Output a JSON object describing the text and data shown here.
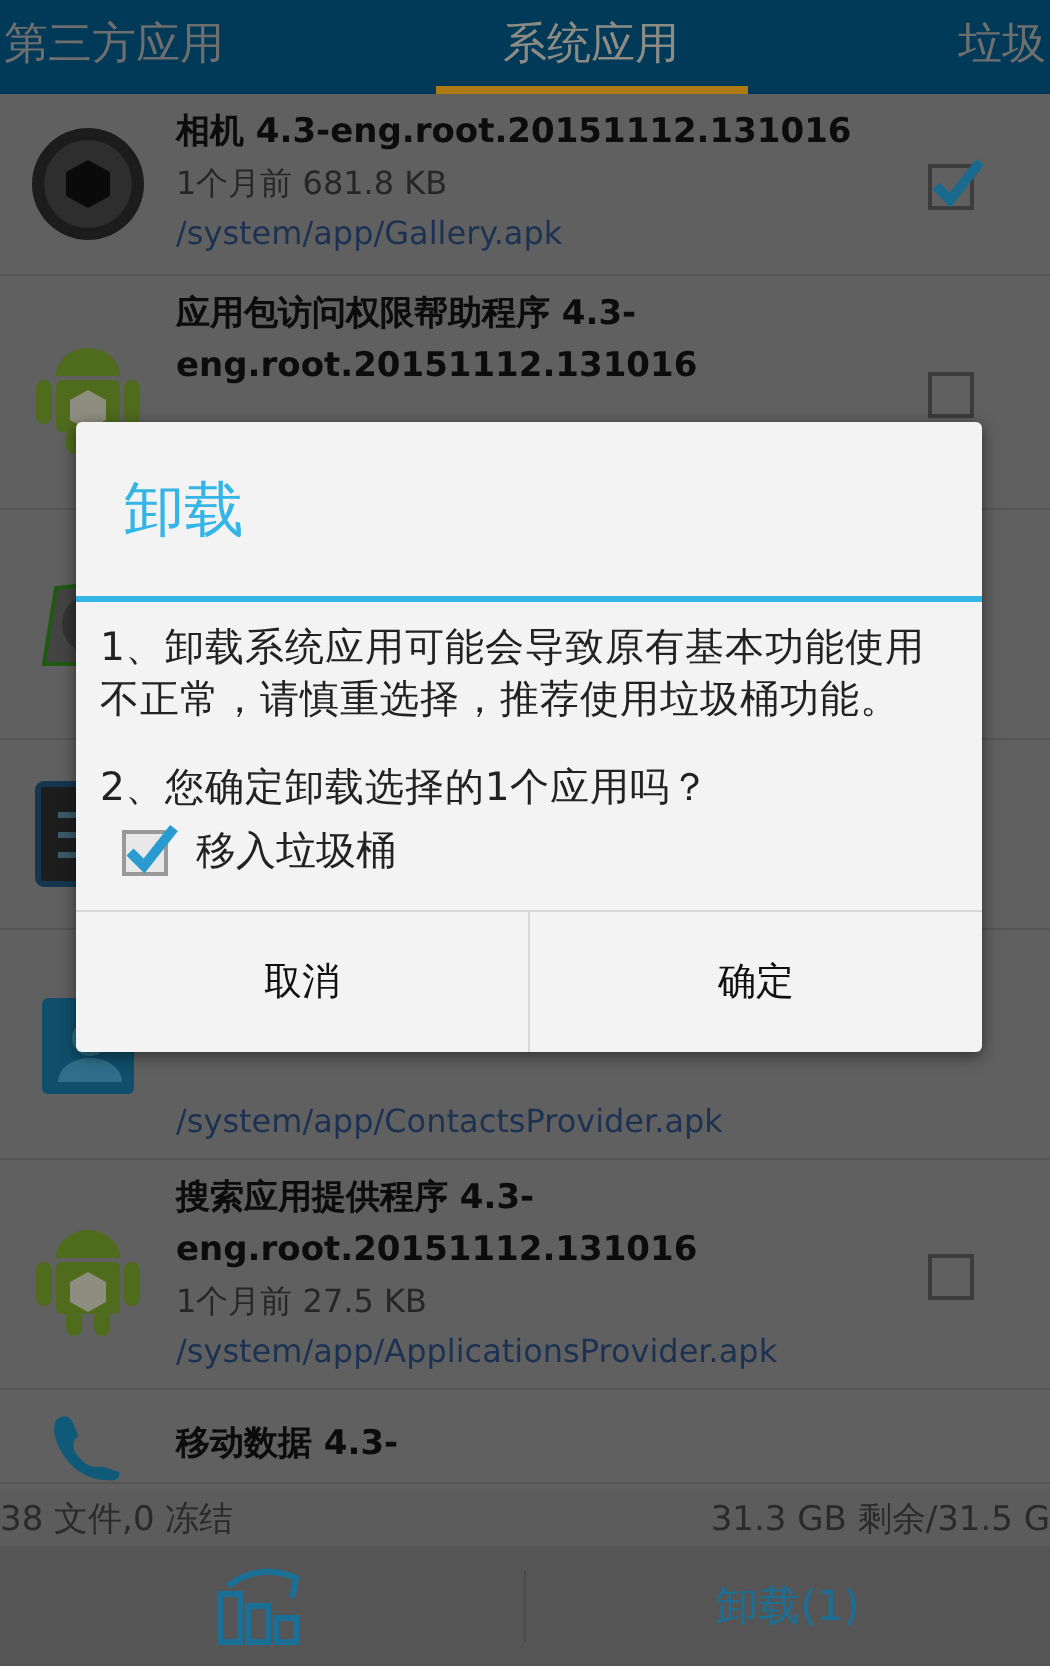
{
  "tabs": [
    {
      "label": "第三方应用",
      "selected": false
    },
    {
      "label": "系统应用",
      "selected": true
    },
    {
      "label": "垃圾",
      "selected": false
    }
  ],
  "apps": [
    {
      "kind": "camera",
      "title": "相机 4.3-eng.root.20151112.131016",
      "meta": "1个月前 681.8 KB",
      "path": "/system/app/Gallery.apk",
      "checked": true
    },
    {
      "kind": "android",
      "title": "应用包访问权限帮助程序 4.3-eng.root.20151112.131016",
      "checked": false
    },
    {
      "kind": "gauge"
    },
    {
      "kind": "panel"
    },
    {
      "kind": "contacts",
      "path": "/system/app/ContactsProvider.apk"
    },
    {
      "kind": "android",
      "title": "搜索应用提供程序 4.3-eng.root.20151112.131016",
      "meta": "1个月前 27.5 KB",
      "path": "/system/app/ApplicationsProvider.apk",
      "checked": false
    },
    {
      "kind": "phone",
      "title": "移动数据 4.3-"
    }
  ],
  "status": {
    "files": "38 文件,0 冻结",
    "storage": "31.3 GB 剩余/31.5 G"
  },
  "bottom_bar": {
    "uninstall_button": "卸载(1)"
  },
  "dialog": {
    "title": "卸载",
    "message_1": "1、卸载系统应用可能会导致原有基本功能使用不正常，请慎重选择，推荐使用垃圾桶功能。",
    "message_2": "2、您确定卸载选择的1个应用吗？",
    "trash_option": {
      "label": "移入垃圾桶",
      "checked": true
    },
    "buttons": [
      "取消",
      "确定"
    ]
  }
}
